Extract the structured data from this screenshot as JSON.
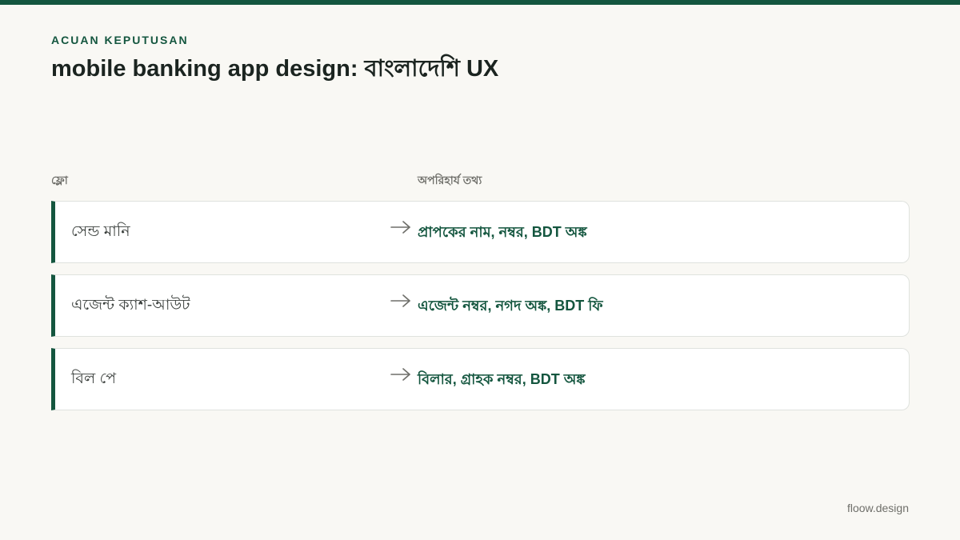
{
  "header": {
    "eyebrow": "ACUAN KEPUTUSAN",
    "title": "mobile banking app design: বাংলাদেশি UX"
  },
  "table": {
    "col_flow": "ফ্লো",
    "col_info": "অপরিহার্য তথ্য",
    "rows": [
      {
        "flow": "সেন্ড মানি",
        "info": "প্রাপকের নাম, নম্বর, BDT অঙ্ক"
      },
      {
        "flow": "এজেন্ট ক্যাশ-আউট",
        "info": "এজেন্ট নম্বর, নগদ অঙ্ক, BDT ফি"
      },
      {
        "flow": "বিল পে",
        "info": "বিলার, গ্রাহক নম্বর, BDT অঙ্ক"
      }
    ]
  },
  "footer": {
    "brand": "floow.design"
  },
  "colors": {
    "accent": "#14563f",
    "background": "#f9f8f4",
    "card": "#ffffff",
    "muted_text": "#6f6f6a"
  },
  "icons": {
    "row_arrow": "arrow-right-icon"
  }
}
